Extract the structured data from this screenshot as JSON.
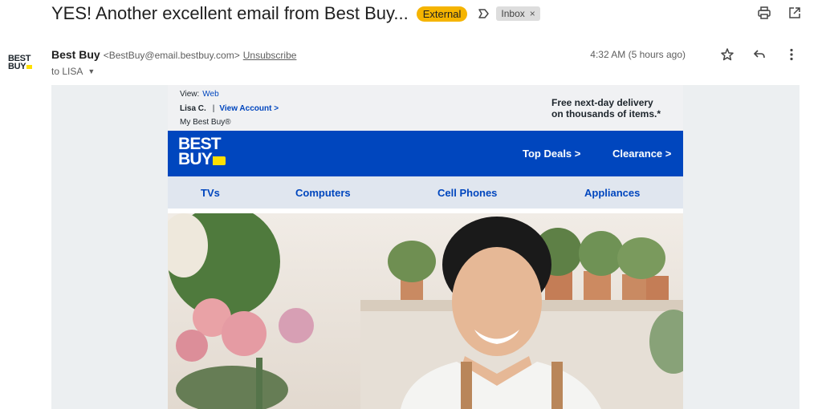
{
  "subject": {
    "title": "YES! Another excellent email from Best Buy...",
    "badge_external": "External",
    "badge_inbox": "Inbox",
    "badge_inbox_close": "×"
  },
  "toolbar": {
    "print_icon": "print-icon",
    "open_icon": "open-in-new-icon"
  },
  "sender": {
    "name": "Best Buy",
    "email": "<BestBuy@email.bestbuy.com>",
    "unsubscribe": "Unsubscribe",
    "to": "to LISA",
    "timestamp": "4:32 AM (5 hours ago)",
    "avatar_text": "BEST BUY"
  },
  "email": {
    "view_label": "View:",
    "view_link": "Web",
    "account_name": "Lisa C.",
    "account_sep": "|",
    "view_account": "View Account >",
    "my_best_buy": "My Best Buy®",
    "free_shipping_line1": "Free next-day delivery",
    "free_shipping_line2": "on thousands of items.*",
    "logo_line1": "BEST",
    "logo_line2": "BUY",
    "top_deals": "Top Deals >",
    "clearance": "Clearance >",
    "categories": [
      "TVs",
      "Computers",
      "Cell Phones",
      "Appliances"
    ]
  },
  "colors": {
    "brand_blue": "#0046be",
    "brand_yellow": "#ffe000",
    "external_badge": "#f5b400"
  }
}
